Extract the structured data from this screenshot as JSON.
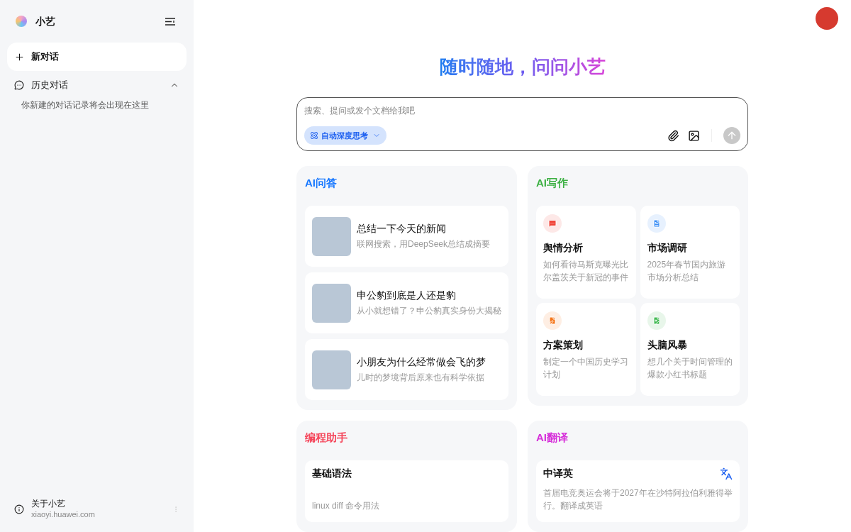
{
  "sidebar": {
    "app_name": "小艺",
    "new_chat": "新对话",
    "history": {
      "label": "历史对话",
      "expanded": true,
      "empty_hint": "你新建的对话记录将会出现在这里"
    },
    "footer": {
      "title": "关于小艺",
      "subtitle": "xiaoyi.huawei.com"
    }
  },
  "headline": "随时随地，问问小艺",
  "composer": {
    "placeholder": "搜索、提问或发个文档给我吧",
    "mode": {
      "label": "自动深度思考",
      "on": true
    },
    "send_disabled": true
  },
  "sections": [
    {
      "kind": "list",
      "title": "AI问答",
      "color": "#1677ff",
      "items": [
        {
          "title": "总结一下今天的新闻",
          "subtitle": "联网搜索，用DeepSeek总结成摘要"
        },
        {
          "title": "申公豹到底是人还是豹",
          "subtitle": "从小就想错了？申公豹真实身份大揭秘"
        },
        {
          "title": "小朋友为什么经常做会飞的梦",
          "subtitle": "儿时的梦境背后原来也有科学依据"
        }
      ]
    },
    {
      "kind": "grid",
      "title": "AI写作",
      "color": "#3cb043",
      "items": [
        {
          "title": "舆情分析",
          "subtitle": "如何看待马斯克曝光比尔盖茨关于新冠的事件",
          "color": "#f04438"
        },
        {
          "title": "市场调研",
          "subtitle": "2025年春节国内旅游市场分析总结",
          "color": "#3a8ef6"
        },
        {
          "title": "方案策划",
          "subtitle": "制定一个中国历史学习计划",
          "color": "#f5761a"
        },
        {
          "title": "头脑风暴",
          "subtitle": "想几个关于时间管理的爆款小红书标题",
          "color": "#3fb950"
        }
      ]
    },
    {
      "kind": "code",
      "title": "编程助手",
      "color": "#f5455a",
      "items": [
        {
          "title": "基础语法",
          "subtitle": "linux diff 命令用法"
        }
      ]
    },
    {
      "kind": "translate",
      "title": "AI翻译",
      "color": "#d62fd9",
      "items": [
        {
          "title": "中译英",
          "subtitle": "首届电竞奥运会将于2027年在沙特阿拉伯利雅得举行。翻译成英语"
        }
      ]
    }
  ]
}
